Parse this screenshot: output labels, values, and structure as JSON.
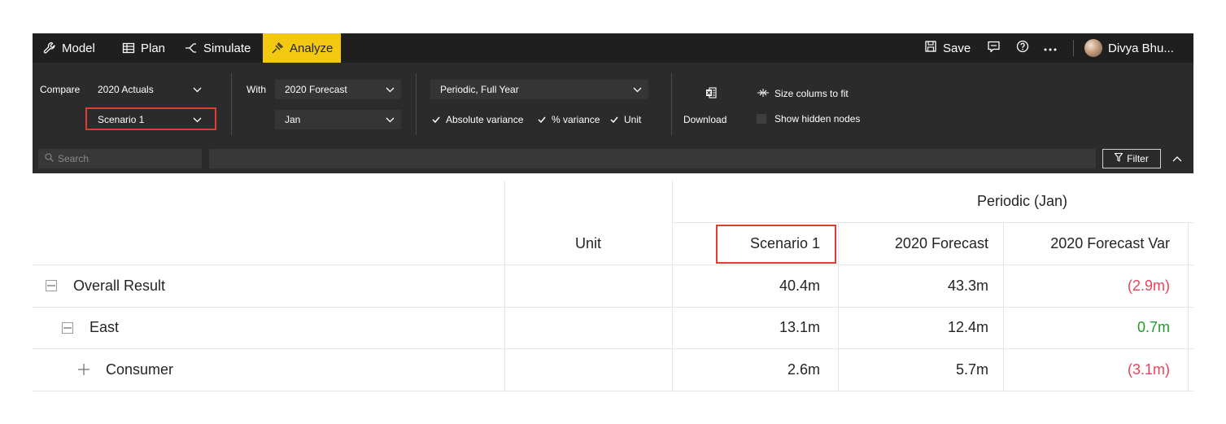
{
  "appbar": {
    "nav": [
      {
        "label": "Model",
        "icon": "wrench-icon"
      },
      {
        "label": "Plan",
        "icon": "table-icon"
      },
      {
        "label": "Simulate",
        "icon": "simulate-icon"
      },
      {
        "label": "Analyze",
        "icon": "analyze-icon",
        "active": true
      }
    ],
    "save_label": "Save",
    "user_name": "Divya Bhu...",
    "accent_color": "#f2c811"
  },
  "toolbar": {
    "compare_label": "Compare",
    "compare_value": "2020 Actuals",
    "compare_scenario": "Scenario 1",
    "with_label": "With",
    "with_value": "2020 Forecast",
    "with_period": "Jan",
    "period_value": "Periodic, Full Year",
    "checks": [
      {
        "label": "Absolute variance",
        "checked": true
      },
      {
        "label": "% variance",
        "checked": true
      },
      {
        "label": "Unit",
        "checked": true
      }
    ],
    "download_label": "Download",
    "size_columns_label": "Size colums to fit",
    "show_hidden_label": "Show hidden nodes",
    "highlight_color": "#e03c31"
  },
  "search": {
    "placeholder": "Search",
    "filter_label": "Filter"
  },
  "grid": {
    "group_header": "Periodic (Jan)",
    "columns": {
      "unit": "Unit",
      "scenario": "Scenario 1",
      "forecast": "2020 Forecast",
      "variance": "2020 Forecast Var"
    },
    "rows": [
      {
        "label": "Overall Result",
        "expander": "minus",
        "unit": "",
        "scenario": "40.4m",
        "forecast": "43.3m",
        "variance": "(2.9m)",
        "variance_sign": "negative"
      },
      {
        "label": "East",
        "expander": "minus",
        "unit": "",
        "scenario": "13.1m",
        "forecast": "12.4m",
        "variance": "0.7m",
        "variance_sign": "positive"
      },
      {
        "label": "Consumer",
        "expander": "plus",
        "unit": "",
        "scenario": "2.6m",
        "forecast": "5.7m",
        "variance": "(3.1m)",
        "variance_sign": "negative"
      }
    ],
    "negative_color": "#e8435a",
    "positive_color": "#1e9c2b"
  }
}
